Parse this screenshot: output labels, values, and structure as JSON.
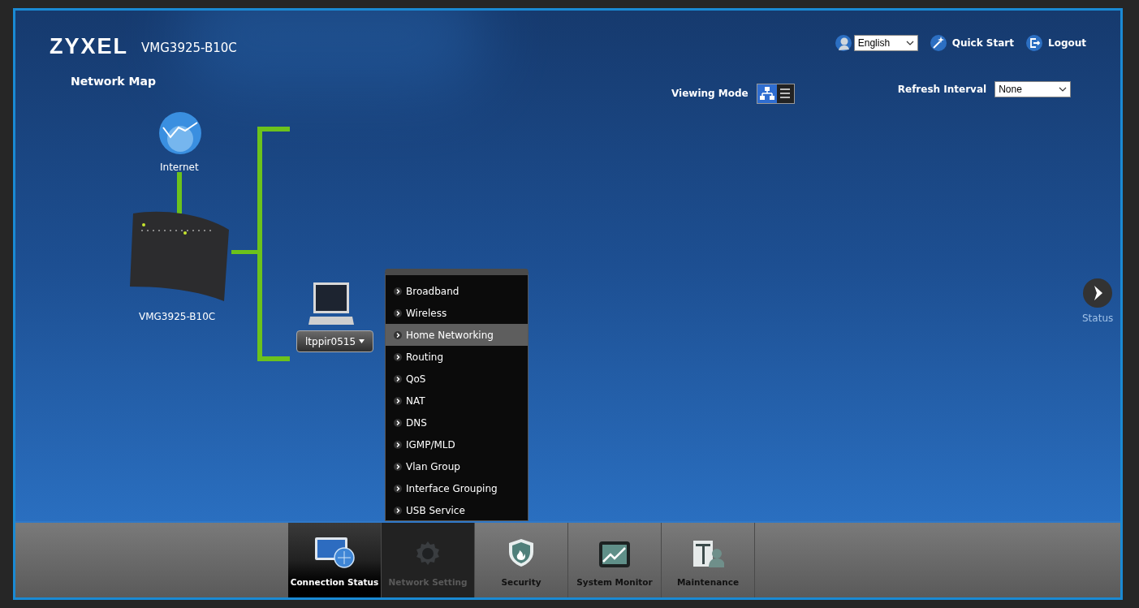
{
  "header": {
    "brand": "ZYXEL",
    "model": "VMG3925-B10C",
    "language": {
      "value": "English"
    },
    "links": [
      {
        "kind": "quickstart",
        "label": "Quick Start"
      },
      {
        "kind": "logout",
        "label": "Logout"
      }
    ]
  },
  "page_title": "Network Map",
  "viewing_mode": {
    "label": "Viewing Mode",
    "options": [
      {
        "kind": "map",
        "selected": true
      },
      {
        "kind": "list",
        "selected": false
      }
    ]
  },
  "refresh_interval": {
    "label": "Refresh Interval",
    "value": "None"
  },
  "network_map": {
    "internet_label": "Internet",
    "router_label": "VMG3925-B10C",
    "device_button": "ltppir0515"
  },
  "menu": [
    {
      "label": "Broadband",
      "selected": false
    },
    {
      "label": "Wireless",
      "selected": false
    },
    {
      "label": "Home Networking",
      "selected": true
    },
    {
      "label": "Routing",
      "selected": false
    },
    {
      "label": "QoS",
      "selected": false
    },
    {
      "label": "NAT",
      "selected": false
    },
    {
      "label": "DNS",
      "selected": false
    },
    {
      "label": "IGMP/MLD",
      "selected": false
    },
    {
      "label": "Vlan Group",
      "selected": false
    },
    {
      "label": "Interface Grouping",
      "selected": false
    },
    {
      "label": "USB Service",
      "selected": false
    }
  ],
  "status_panel": {
    "label": "Status"
  },
  "nav_tabs": [
    {
      "kind": "connection",
      "label": "Connection Status",
      "selected": true,
      "expanded": false
    },
    {
      "kind": "network",
      "label": "Network Setting",
      "selected": false,
      "expanded": true
    },
    {
      "kind": "security",
      "label": "Security",
      "selected": false,
      "expanded": false
    },
    {
      "kind": "monitor",
      "label": "System Monitor",
      "selected": false,
      "expanded": false
    },
    {
      "kind": "maintenance",
      "label": "Maintenance",
      "selected": false,
      "expanded": false
    }
  ]
}
